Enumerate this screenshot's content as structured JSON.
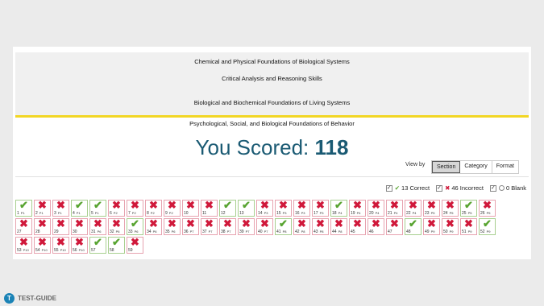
{
  "sections": [
    "Chemical and Physical Foundations of Biological Systems",
    "Critical Analysis and Reasoning Skills",
    "Biological and Biochemical Foundations of Living Systems",
    "Psychological, Social, and Biological Foundations of Behavior"
  ],
  "score": {
    "label": "You Scored:",
    "value": "118"
  },
  "view": {
    "label": "View by",
    "options": [
      "Section",
      "Category",
      "Format"
    ],
    "active": "Section"
  },
  "filters": {
    "correct": "13 Correct",
    "incorrect": "46 Incorrect",
    "blank": "0 Blank"
  },
  "questions": [
    {
      "label": "1",
      "passage": "P1",
      "correct": true
    },
    {
      "label": "2",
      "passage": "P1",
      "correct": false
    },
    {
      "label": "3",
      "passage": "P1",
      "correct": false
    },
    {
      "label": "4",
      "passage": "P1",
      "correct": true
    },
    {
      "label": "5",
      "passage": "P1",
      "correct": true
    },
    {
      "label": "6",
      "passage": "P2",
      "correct": false
    },
    {
      "label": "7",
      "passage": "P2",
      "correct": false
    },
    {
      "label": "8",
      "passage": "P2",
      "correct": false
    },
    {
      "label": "9",
      "passage": "P2",
      "correct": false
    },
    {
      "label": "10",
      "passage": "",
      "correct": false
    },
    {
      "label": "11",
      "passage": "",
      "correct": false
    },
    {
      "label": "12",
      "passage": "",
      "correct": true
    },
    {
      "label": "13",
      "passage": "",
      "correct": true
    },
    {
      "label": "14",
      "passage": "P3",
      "correct": false
    },
    {
      "label": "15",
      "passage": "P3",
      "correct": false
    },
    {
      "label": "16",
      "passage": "P3",
      "correct": false
    },
    {
      "label": "17",
      "passage": "P3",
      "correct": false
    },
    {
      "label": "18",
      "passage": "P4",
      "correct": true
    },
    {
      "label": "19",
      "passage": "P4",
      "correct": false
    },
    {
      "label": "20",
      "passage": "P4",
      "correct": false
    },
    {
      "label": "21",
      "passage": "P4",
      "correct": false
    },
    {
      "label": "22",
      "passage": "P4",
      "correct": false
    },
    {
      "label": "23",
      "passage": "P5",
      "correct": false
    },
    {
      "label": "24",
      "passage": "P5",
      "correct": false
    },
    {
      "label": "25",
      "passage": "P5",
      "correct": true
    },
    {
      "label": "26",
      "passage": "P5",
      "correct": false
    },
    {
      "label": "27",
      "passage": "",
      "correct": false
    },
    {
      "label": "28",
      "passage": "",
      "correct": false
    },
    {
      "label": "29",
      "passage": "",
      "correct": false
    },
    {
      "label": "30",
      "passage": "",
      "correct": false
    },
    {
      "label": "31",
      "passage": "P6",
      "correct": false
    },
    {
      "label": "32",
      "passage": "P6",
      "correct": false
    },
    {
      "label": "33",
      "passage": "P6",
      "correct": true
    },
    {
      "label": "34",
      "passage": "P6",
      "correct": false
    },
    {
      "label": "35",
      "passage": "P6",
      "correct": false
    },
    {
      "label": "36",
      "passage": "P7",
      "correct": false
    },
    {
      "label": "37",
      "passage": "P7",
      "correct": false
    },
    {
      "label": "38",
      "passage": "P7",
      "correct": false
    },
    {
      "label": "39",
      "passage": "P7",
      "correct": false
    },
    {
      "label": "40",
      "passage": "P7",
      "correct": false
    },
    {
      "label": "41",
      "passage": "P8",
      "correct": true
    },
    {
      "label": "42",
      "passage": "P8",
      "correct": false
    },
    {
      "label": "43",
      "passage": "P8",
      "correct": false
    },
    {
      "label": "44",
      "passage": "P8",
      "correct": false
    },
    {
      "label": "45",
      "passage": "",
      "correct": false
    },
    {
      "label": "46",
      "passage": "",
      "correct": false
    },
    {
      "label": "47",
      "passage": "",
      "correct": false
    },
    {
      "label": "48",
      "passage": "",
      "correct": true
    },
    {
      "label": "49",
      "passage": "P9",
      "correct": false
    },
    {
      "label": "50",
      "passage": "P9",
      "correct": false
    },
    {
      "label": "51",
      "passage": "P9",
      "correct": false
    },
    {
      "label": "52",
      "passage": "P9",
      "correct": true
    },
    {
      "label": "53",
      "passage": "P10",
      "correct": false
    },
    {
      "label": "54",
      "passage": "P10",
      "correct": false
    },
    {
      "label": "55",
      "passage": "P10",
      "correct": false
    },
    {
      "label": "56",
      "passage": "P10",
      "correct": false
    },
    {
      "label": "57",
      "passage": "",
      "correct": true
    },
    {
      "label": "58",
      "passage": "",
      "correct": true
    },
    {
      "label": "59",
      "passage": "",
      "correct": false
    }
  ],
  "icons": {
    "correct": "check-icon",
    "incorrect": "x-icon",
    "blank": "circle-icon"
  },
  "colors": {
    "correct": "#58a431",
    "incorrect": "#d0193b",
    "accent": "#f2d624",
    "score": "#1a5a73",
    "brand": "#1b83b6"
  },
  "brand": {
    "name": "TEST-GUIDE",
    "logo_letter": "T"
  }
}
